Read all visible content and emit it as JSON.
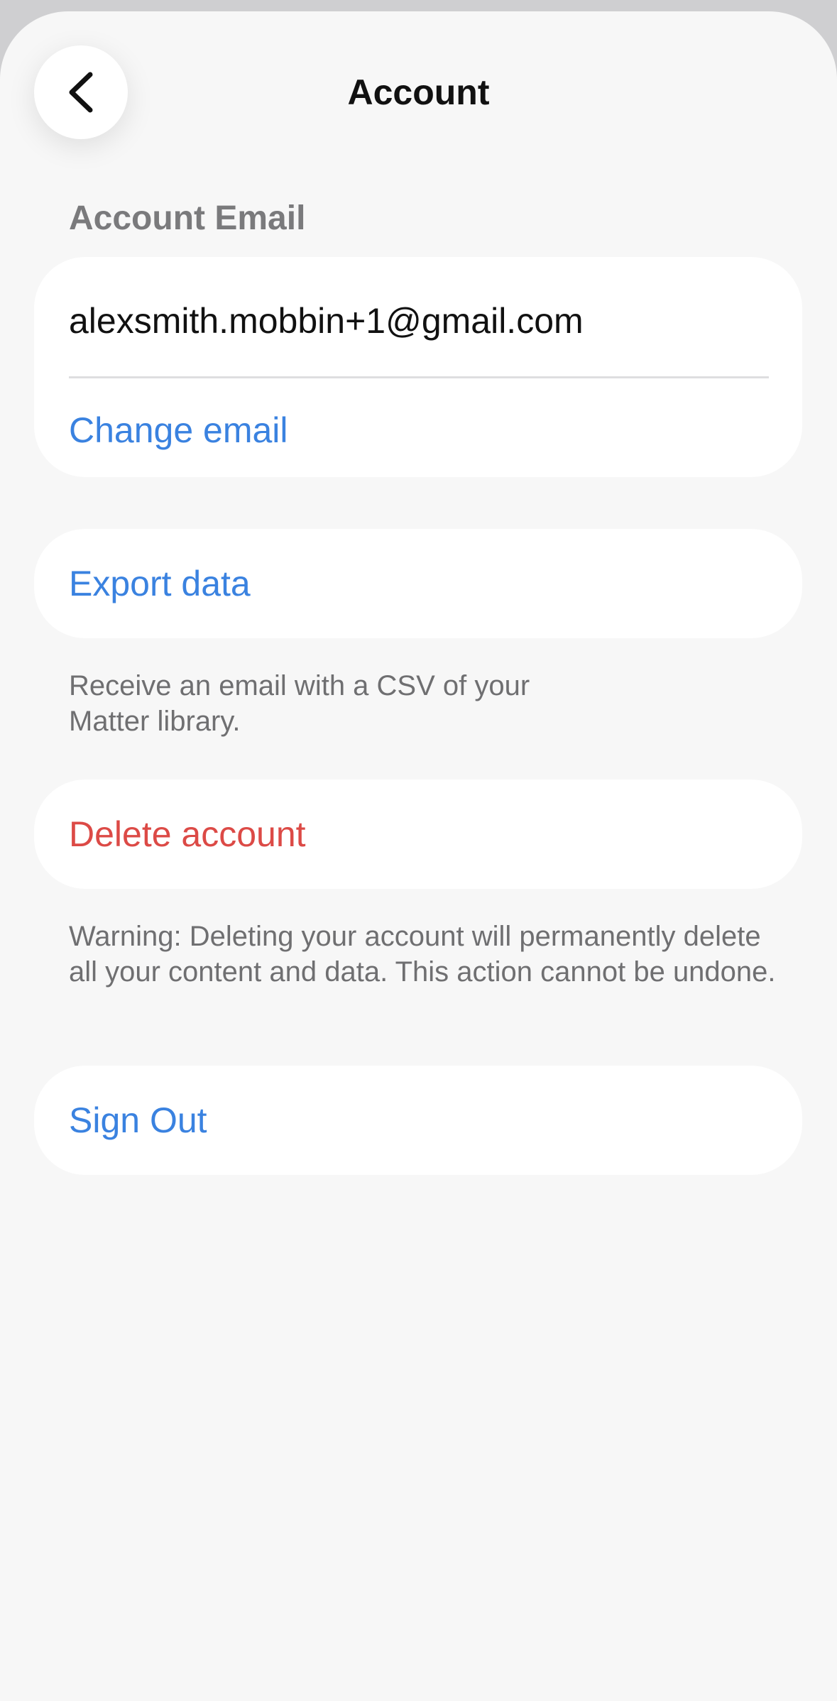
{
  "header": {
    "title": "Account",
    "back_icon": "chevron-left-icon"
  },
  "account_email": {
    "section_label": "Account Email",
    "email": "alexsmith.mobbin+1@gmail.com",
    "change_label": "Change email"
  },
  "export": {
    "label": "Export data",
    "note": "Receive an email with a CSV of your Matter library."
  },
  "delete": {
    "label": "Delete account",
    "note": "Warning: Deleting your account will permanently delete all your content and data. This action cannot be undone."
  },
  "sign_out": {
    "label": "Sign Out"
  },
  "colors": {
    "accent": "#3a82e0",
    "danger": "#dc4a46",
    "background": "#f7f7f7",
    "card": "#ffffff",
    "secondary_text": "#6f6f71"
  }
}
